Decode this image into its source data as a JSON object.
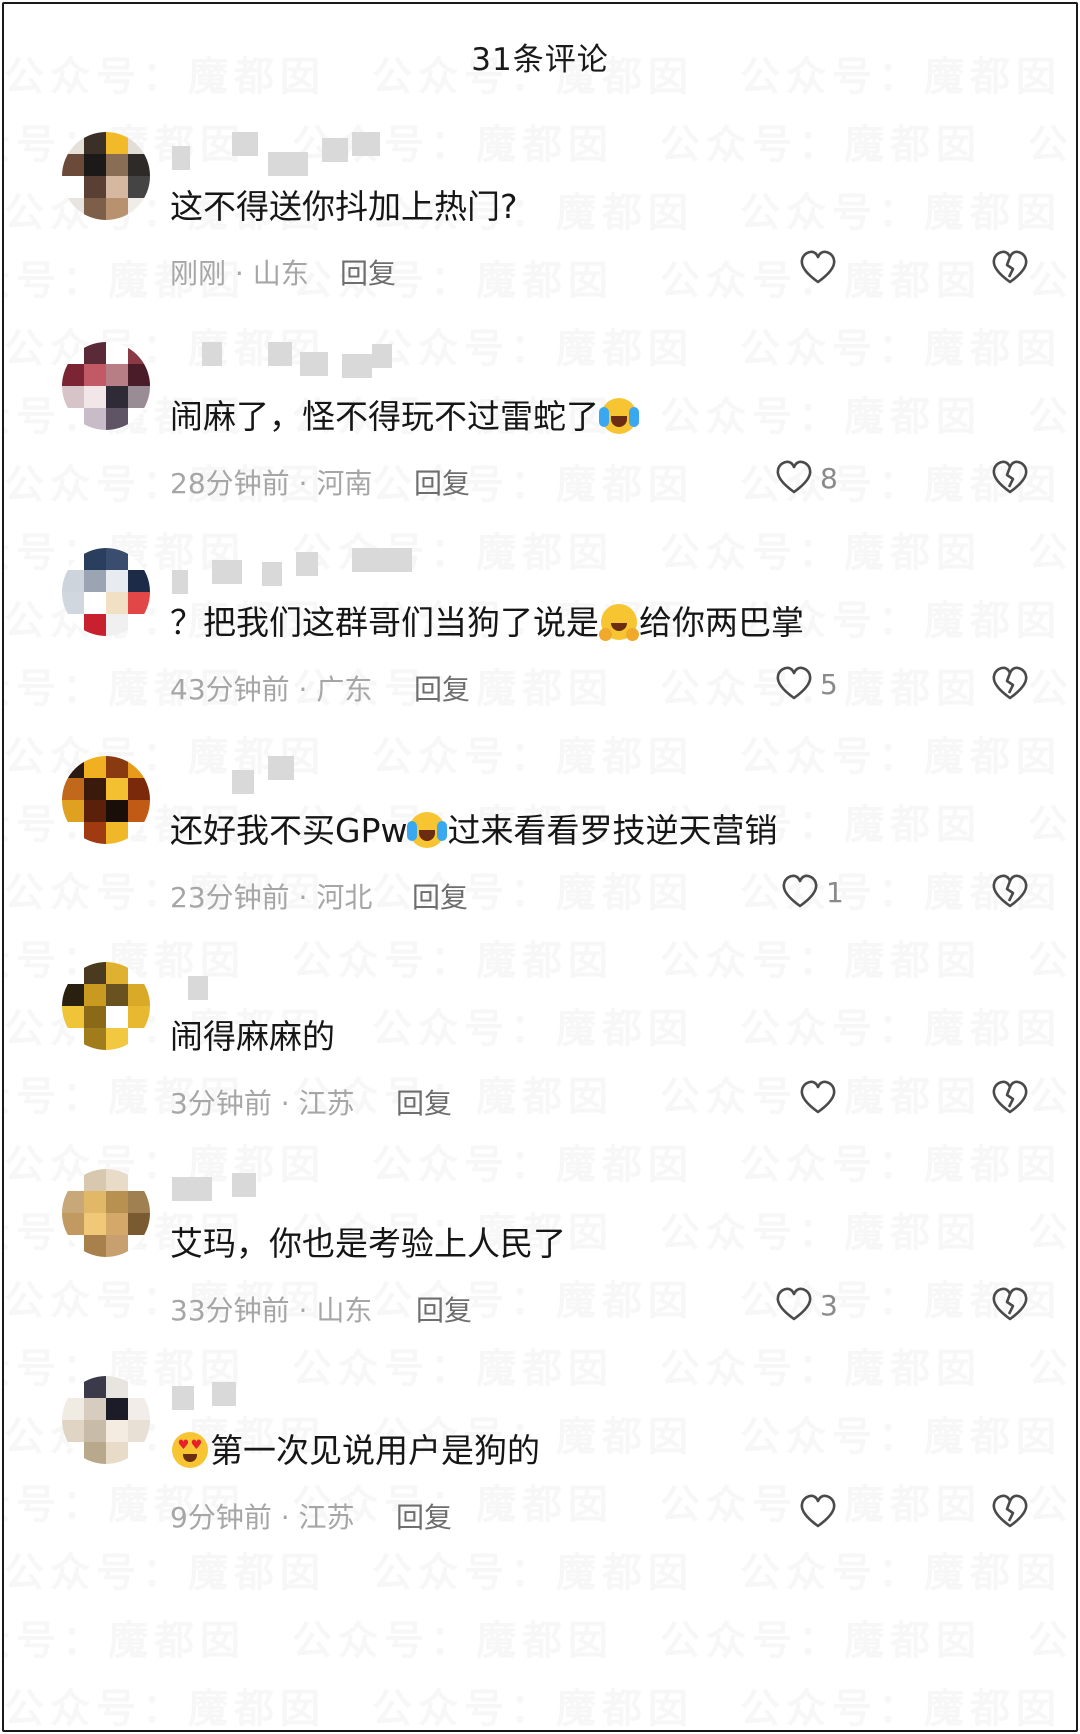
{
  "header": {
    "title": "31条评论"
  },
  "watermark": {
    "text": "公众号：魔都囡"
  },
  "comments": [
    {
      "text": "这不得送你抖加上热门?",
      "emoji": "",
      "time": "刚刚",
      "location": "山东",
      "reply_label": "回复",
      "likes": "",
      "avatar_colors": [
        "#e5e0d8",
        "#3a3028",
        "#f2b928",
        "#e2ddd6",
        "#6b4a3a",
        "#1c1a18",
        "#8a6d55",
        "#2e2a28",
        "#ffffff",
        "#5a3f35",
        "#d6b7a0",
        "#444444",
        "#e8e4df",
        "#7c5e49",
        "#b8916f",
        "#f0ede9"
      ]
    },
    {
      "text": "闹麻了，怪不得玩不过雷蛇了",
      "emoji": "cry",
      "time": "28分钟前",
      "location": "河南",
      "reply_label": "回复",
      "likes": "8",
      "avatar_colors": [
        "#ffffff",
        "#5a2a38",
        "#ffffff",
        "#8a3a44",
        "#7a2434",
        "#c25a66",
        "#b77e86",
        "#4a1c2a",
        "#d7c4c8",
        "#f2e6e8",
        "#2e2a36",
        "#9a8c94",
        "#ffffff",
        "#c8bcc8",
        "#5e5466",
        "#ffffff"
      ]
    },
    {
      "text": "？把我们这群哥们当狗了说是",
      "emoji": "hug",
      "text_after": "给你两巴掌",
      "time": "43分钟前",
      "location": "广东",
      "reply_label": "回复",
      "likes": "5",
      "avatar_colors": [
        "#ffffff",
        "#2a3e5e",
        "#3b4d6e",
        "#ffffff",
        "#ced4dc",
        "#9aa4b2",
        "#e8ecf0",
        "#1c2c48",
        "#d1d7de",
        "#ffffff",
        "#f2e0c4",
        "#e34646",
        "#ffffff",
        "#c8202e",
        "#f0f0f0",
        "#ffffff"
      ]
    },
    {
      "text": "还好我不买GPw",
      "emoji": "cry",
      "text_after": "过来看看罗技逆天营销",
      "time": "23分钟前",
      "location": "河北",
      "reply_label": "回复",
      "likes": "1",
      "avatar_colors": [
        "#2a1a12",
        "#f0b020",
        "#8a3a10",
        "#e89a1a",
        "#c2681a",
        "#3a1a0a",
        "#f2c030",
        "#7a2a0a",
        "#e0a020",
        "#5a200a",
        "#1a0e08",
        "#c05a14",
        "#ffffff",
        "#a03a10",
        "#f0b828",
        "#ffffff"
      ]
    },
    {
      "text": "闹得麻麻的",
      "emoji": "",
      "time": "3分钟前",
      "location": "江苏",
      "reply_label": "回复",
      "likes": "",
      "avatar_colors": [
        "#ffffff",
        "#4a3a20",
        "#e0b030",
        "#ffffff",
        "#2a2010",
        "#c89a20",
        "#6a5220",
        "#d8aa28",
        "#f0c438",
        "#8a6a18",
        "#ffffff",
        "#e8b830",
        "#ffffff",
        "#a07c1c",
        "#f2c840",
        "#ffffff"
      ]
    },
    {
      "text": "艾玛，你也是考验上人民了",
      "emoji": "",
      "time": "33分钟前",
      "location": "山东",
      "reply_label": "回复",
      "likes": "3",
      "avatar_colors": [
        "#ffffff",
        "#d8c8b0",
        "#e8dcc8",
        "#ffffff",
        "#c8a878",
        "#e0b868",
        "#b89050",
        "#a08050",
        "#c09a60",
        "#f0c878",
        "#d4a868",
        "#7a5a30",
        "#ffffff",
        "#a8804c",
        "#c8a070",
        "#ffffff"
      ]
    },
    {
      "text": "第一次见说用户是狗的",
      "emoji": "heart",
      "emoji_first": true,
      "time": "9分钟前",
      "location": "江苏",
      "reply_label": "回复",
      "likes": "",
      "avatar_colors": [
        "#ffffff",
        "#3a3a4a",
        "#e8e4e0",
        "#ffffff",
        "#f0ece4",
        "#d8ccc0",
        "#1c1c28",
        "#f2ede8",
        "#e0d4c4",
        "#c8bca8",
        "#f4ece0",
        "#e8e0d4",
        "#ffffff",
        "#b8a88c",
        "#e8dcc8",
        "#ffffff"
      ]
    }
  ]
}
